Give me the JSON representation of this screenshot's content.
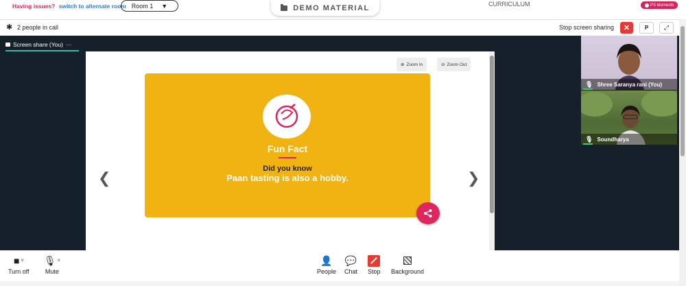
{
  "top": {
    "issues_text": "Having issues?",
    "alt_room_link": "switch to alternate room",
    "room_selected": "Room 1",
    "demo_tab": "DEMO MATERIAL",
    "curriculum": "CURRICULUM",
    "moments_badge": "PS Moments"
  },
  "call": {
    "people_count": "2 people in call",
    "stop_sharing_label": "Stop screen sharing",
    "stop_button": "✕",
    "p_button": "P"
  },
  "stage": {
    "share_tab": "Screen share (You)",
    "share_tab_menu": "···",
    "zoom_in": "Zoom In",
    "zoom_out": "Zoom Out"
  },
  "slide": {
    "title": "Fun Fact",
    "subtitle": "Did you know",
    "fact": "Paan tasting is also a hobby."
  },
  "participants": [
    {
      "name": "Shree Saranya rani (You)"
    },
    {
      "name": "Soundharya"
    }
  ],
  "controls": {
    "camera_label": "Turn off",
    "mic_label": "Mute",
    "people_label": "People",
    "chat_label": "Chat",
    "stop_label": "Stop",
    "background_label": "Background"
  },
  "colors": {
    "accent_red": "#e53935",
    "slide_yellow": "#f0b312",
    "brand_pink": "#d6245a",
    "stage_dark": "#16202a",
    "active_green": "#3bb7a3"
  }
}
